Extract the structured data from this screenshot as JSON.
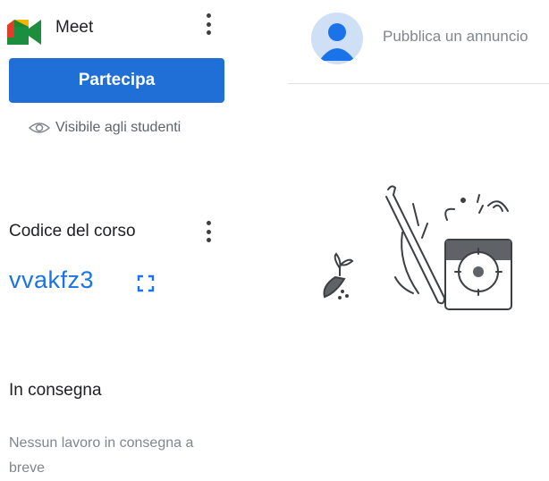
{
  "meet": {
    "title": "Meet",
    "join_label": "Partecipa",
    "visibility": "Visibile agli studenti"
  },
  "course_code": {
    "label": "Codice del corso",
    "code": "vvakfz3"
  },
  "due": {
    "title": "In consegna",
    "text": "Nessun lavoro in consegna a breve"
  },
  "stream": {
    "announce_placeholder": "Pubblica un annuncio"
  },
  "colors": {
    "accent": "#1a73e8",
    "button": "#1f6fd6"
  },
  "icons": [
    "meet-logo-icon",
    "more-vert-icon",
    "eye-icon",
    "fullscreen-icon",
    "avatar-icon"
  ]
}
